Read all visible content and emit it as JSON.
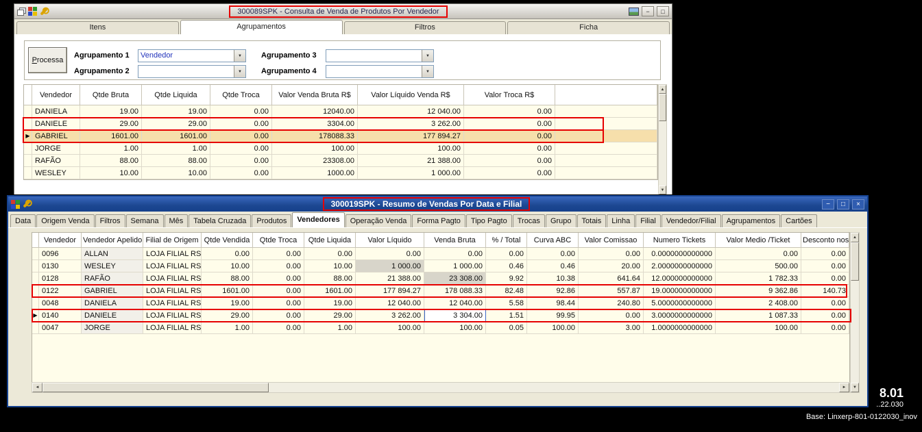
{
  "icons": {
    "up": "▲",
    "down": "▼",
    "left": "◄",
    "right": "►"
  },
  "desktop": {
    "footer_version_large": "8.01",
    "footer_version_small": "..22.030",
    "footer_base": "Base: Linxerp-801-0122030_inov"
  },
  "top_window": {
    "title": "300089SPK - Consulta de Venda de Produtos Por Vendedor",
    "window_buttons": {
      "minimize": "−",
      "maximize": "□"
    },
    "tabs": [
      {
        "label": "Itens",
        "active": false
      },
      {
        "label": "Agrupamentos",
        "active": true
      },
      {
        "label": "Filtros",
        "active": false
      },
      {
        "label": "Ficha",
        "active": false
      }
    ],
    "group": {
      "processa": "Processa",
      "fields": [
        {
          "label": "Agrupamento 1",
          "value": "Vendedor"
        },
        {
          "label": "Agrupamento 2",
          "value": ""
        },
        {
          "label": "Agrupamento 3",
          "value": ""
        },
        {
          "label": "Agrupamento 4",
          "value": ""
        }
      ]
    },
    "grid": {
      "row_arrow": "▶",
      "columns": [
        "Vendedor",
        "Qtde Bruta",
        "Qtde Liquida",
        "Qtde Troca",
        "Valor Venda Bruta R$",
        "Valor Líquido Venda R$",
        "Valor Troca R$"
      ],
      "rows": [
        {
          "cells": [
            "DANIELA",
            "19.00",
            "19.00",
            "0.00",
            "12040.00",
            "12 040.00",
            "0.00"
          ],
          "selected": false
        },
        {
          "cells": [
            "DANIELE",
            "29.00",
            "29.00",
            "0.00",
            "3304.00",
            "3 262.00",
            "0.00"
          ],
          "selected": false
        },
        {
          "cells": [
            "GABRIEL",
            "1601.00",
            "1601.00",
            "0.00",
            "178088.33",
            "177 894.27",
            "0.00"
          ],
          "selected": true
        },
        {
          "cells": [
            "JORGE",
            "1.00",
            "1.00",
            "0.00",
            "100.00",
            "100.00",
            "0.00"
          ],
          "selected": false
        },
        {
          "cells": [
            "RAFÃO",
            "88.00",
            "88.00",
            "0.00",
            "23308.00",
            "21 388.00",
            "0.00"
          ],
          "selected": false
        },
        {
          "cells": [
            "WESLEY",
            "10.00",
            "10.00",
            "0.00",
            "1000.00",
            "1 000.00",
            "0.00"
          ],
          "selected": false
        }
      ]
    }
  },
  "bottom_window": {
    "title": "300019SPK - Resumo de Vendas Por Data e Filial",
    "window_buttons": {
      "minimize": "−",
      "maximize": "□",
      "close": "×"
    },
    "active_tab": "Vendedores",
    "tabs": [
      "Data",
      "Origem Venda",
      "Filtros",
      "Semana",
      "Mês",
      "Tabela Cruzada",
      "Produtos",
      "Vendedores",
      "Operação Venda",
      "Forma Pagto",
      "Tipo Pagto",
      "Trocas",
      "Grupo",
      "Totais",
      "Linha",
      "Filial",
      "Vendedor/Filial",
      "Agrupamentos",
      "Cartões"
    ],
    "toolbar_icons": [
      {
        "name": "sum-icon",
        "glyph": "Σ"
      },
      {
        "name": "export-grid-icon",
        "glyph": "▦"
      },
      {
        "name": "download-icon",
        "glyph": "▼"
      }
    ],
    "grid": {
      "row_arrow": "▶",
      "arrow_row": 5,
      "focused_cell": {
        "row": 5,
        "col": 7
      },
      "gray_cells": [
        {
          "row": 1,
          "col": 6
        },
        {
          "row": 2,
          "col": 7
        }
      ],
      "columns": [
        "Vendedor",
        "Vendedor Apelido",
        "Filial de Origem",
        "Qtde Vendida",
        "Qtde Troca",
        "Qtde Liquida",
        "Valor Líquido",
        "Venda Bruta",
        "% / Total",
        "Curva ABC",
        "Valor Comissao",
        "Numero Tickets",
        "Valor Medio /Ticket",
        "Desconto nos Tick"
      ],
      "rows": [
        [
          "0096",
          "ALLAN",
          "LOJA FILIAL RS",
          "0.00",
          "0.00",
          "0.00",
          "0.00",
          "0.00",
          "0.00",
          "0.00",
          "0.00",
          "0.0000000000000",
          "0.00",
          "0.00"
        ],
        [
          "0130",
          "WESLEY",
          "LOJA FILIAL RS",
          "10.00",
          "0.00",
          "10.00",
          "1 000.00",
          "1 000.00",
          "0.46",
          "0.46",
          "20.00",
          "2.0000000000000",
          "500.00",
          "0.00"
        ],
        [
          "0128",
          "RAFÃO",
          "LOJA FILIAL RS",
          "88.00",
          "0.00",
          "88.00",
          "21 388.00",
          "23 308.00",
          "9.92",
          "10.38",
          "641.64",
          "12.000000000000",
          "1 782.33",
          "0.00"
        ],
        [
          "0122",
          "GABRIEL",
          "LOJA FILIAL RS",
          "1601.00",
          "0.00",
          "1601.00",
          "177 894.27",
          "178 088.33",
          "82.48",
          "92.86",
          "557.87",
          "19.000000000000",
          "9 362.86",
          "140.73"
        ],
        [
          "0048",
          "DANIELA",
          "LOJA FILIAL RS",
          "19.00",
          "0.00",
          "19.00",
          "12 040.00",
          "12 040.00",
          "5.58",
          "98.44",
          "240.80",
          "5.0000000000000",
          "2 408.00",
          "0.00"
        ],
        [
          "0140",
          "DANIELE",
          "LOJA FILIAL RS",
          "29.00",
          "0.00",
          "29.00",
          "3 262.00",
          "3 304.00",
          "1.51",
          "99.95",
          "0.00",
          "3.0000000000000",
          "1 087.33",
          "0.00"
        ],
        [
          "0047",
          "JORGE",
          "LOJA FILIAL RS",
          "1.00",
          "0.00",
          "1.00",
          "100.00",
          "100.00",
          "0.05",
          "100.00",
          "3.00",
          "1.0000000000000",
          "100.00",
          "0.00"
        ]
      ]
    }
  }
}
